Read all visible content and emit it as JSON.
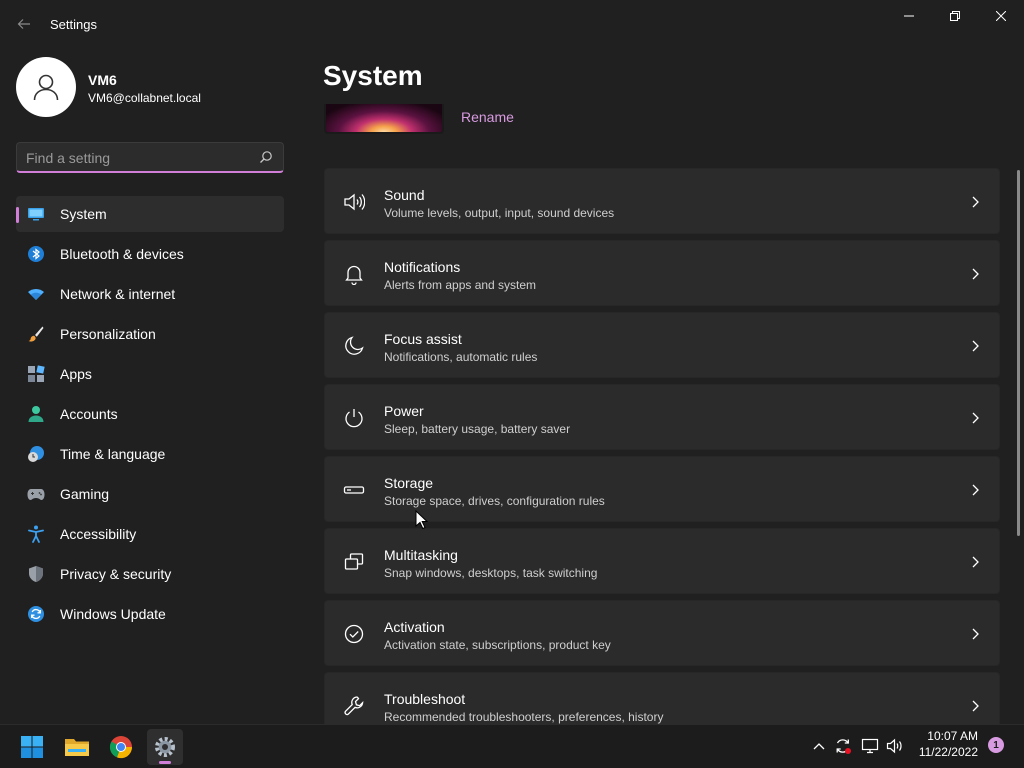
{
  "window": {
    "title": "Settings"
  },
  "profile": {
    "name": "VM6",
    "email": "VM6@collabnet.local"
  },
  "search": {
    "placeholder": "Find a setting",
    "value": ""
  },
  "sidebar": {
    "items": [
      {
        "label": "System",
        "icon": "monitor-icon",
        "active": true
      },
      {
        "label": "Bluetooth & devices",
        "icon": "bluetooth-icon"
      },
      {
        "label": "Network & internet",
        "icon": "wifi-icon"
      },
      {
        "label": "Personalization",
        "icon": "brush-icon"
      },
      {
        "label": "Apps",
        "icon": "apps-icon"
      },
      {
        "label": "Accounts",
        "icon": "person-icon"
      },
      {
        "label": "Time & language",
        "icon": "clock-globe-icon"
      },
      {
        "label": "Gaming",
        "icon": "gamepad-icon"
      },
      {
        "label": "Accessibility",
        "icon": "accessibility-icon"
      },
      {
        "label": "Privacy & security",
        "icon": "shield-icon"
      },
      {
        "label": "Windows Update",
        "icon": "update-icon"
      }
    ]
  },
  "main": {
    "page_title": "System",
    "rename_label": "Rename",
    "cards": [
      {
        "title": "Sound",
        "subtitle": "Volume levels, output, input, sound devices",
        "icon": "speaker-icon"
      },
      {
        "title": "Notifications",
        "subtitle": "Alerts from apps and system",
        "icon": "bell-icon"
      },
      {
        "title": "Focus assist",
        "subtitle": "Notifications, automatic rules",
        "icon": "moon-icon"
      },
      {
        "title": "Power",
        "subtitle": "Sleep, battery usage, battery saver",
        "icon": "power-icon"
      },
      {
        "title": "Storage",
        "subtitle": "Storage space, drives, configuration rules",
        "icon": "drive-icon"
      },
      {
        "title": "Multitasking",
        "subtitle": "Snap windows, desktops, task switching",
        "icon": "multitask-icon"
      },
      {
        "title": "Activation",
        "subtitle": "Activation state, subscriptions, product key",
        "icon": "check-circle-icon"
      },
      {
        "title": "Troubleshoot",
        "subtitle": "Recommended troubleshooters, preferences, history",
        "icon": "wrench-icon"
      }
    ]
  },
  "taskbar": {
    "apps": [
      "start-icon",
      "file-explorer-icon",
      "chrome-icon",
      "settings-icon"
    ],
    "tray": [
      "chevron-up-icon",
      "sync-icon",
      "network-icon",
      "volume-icon"
    ],
    "time": "10:07 AM",
    "date": "11/22/2022",
    "notification_count": "1"
  },
  "colors": {
    "accent": "#d07ed8",
    "link": "#d89ae0",
    "background": "#202020",
    "card": "#2b2b2b"
  }
}
